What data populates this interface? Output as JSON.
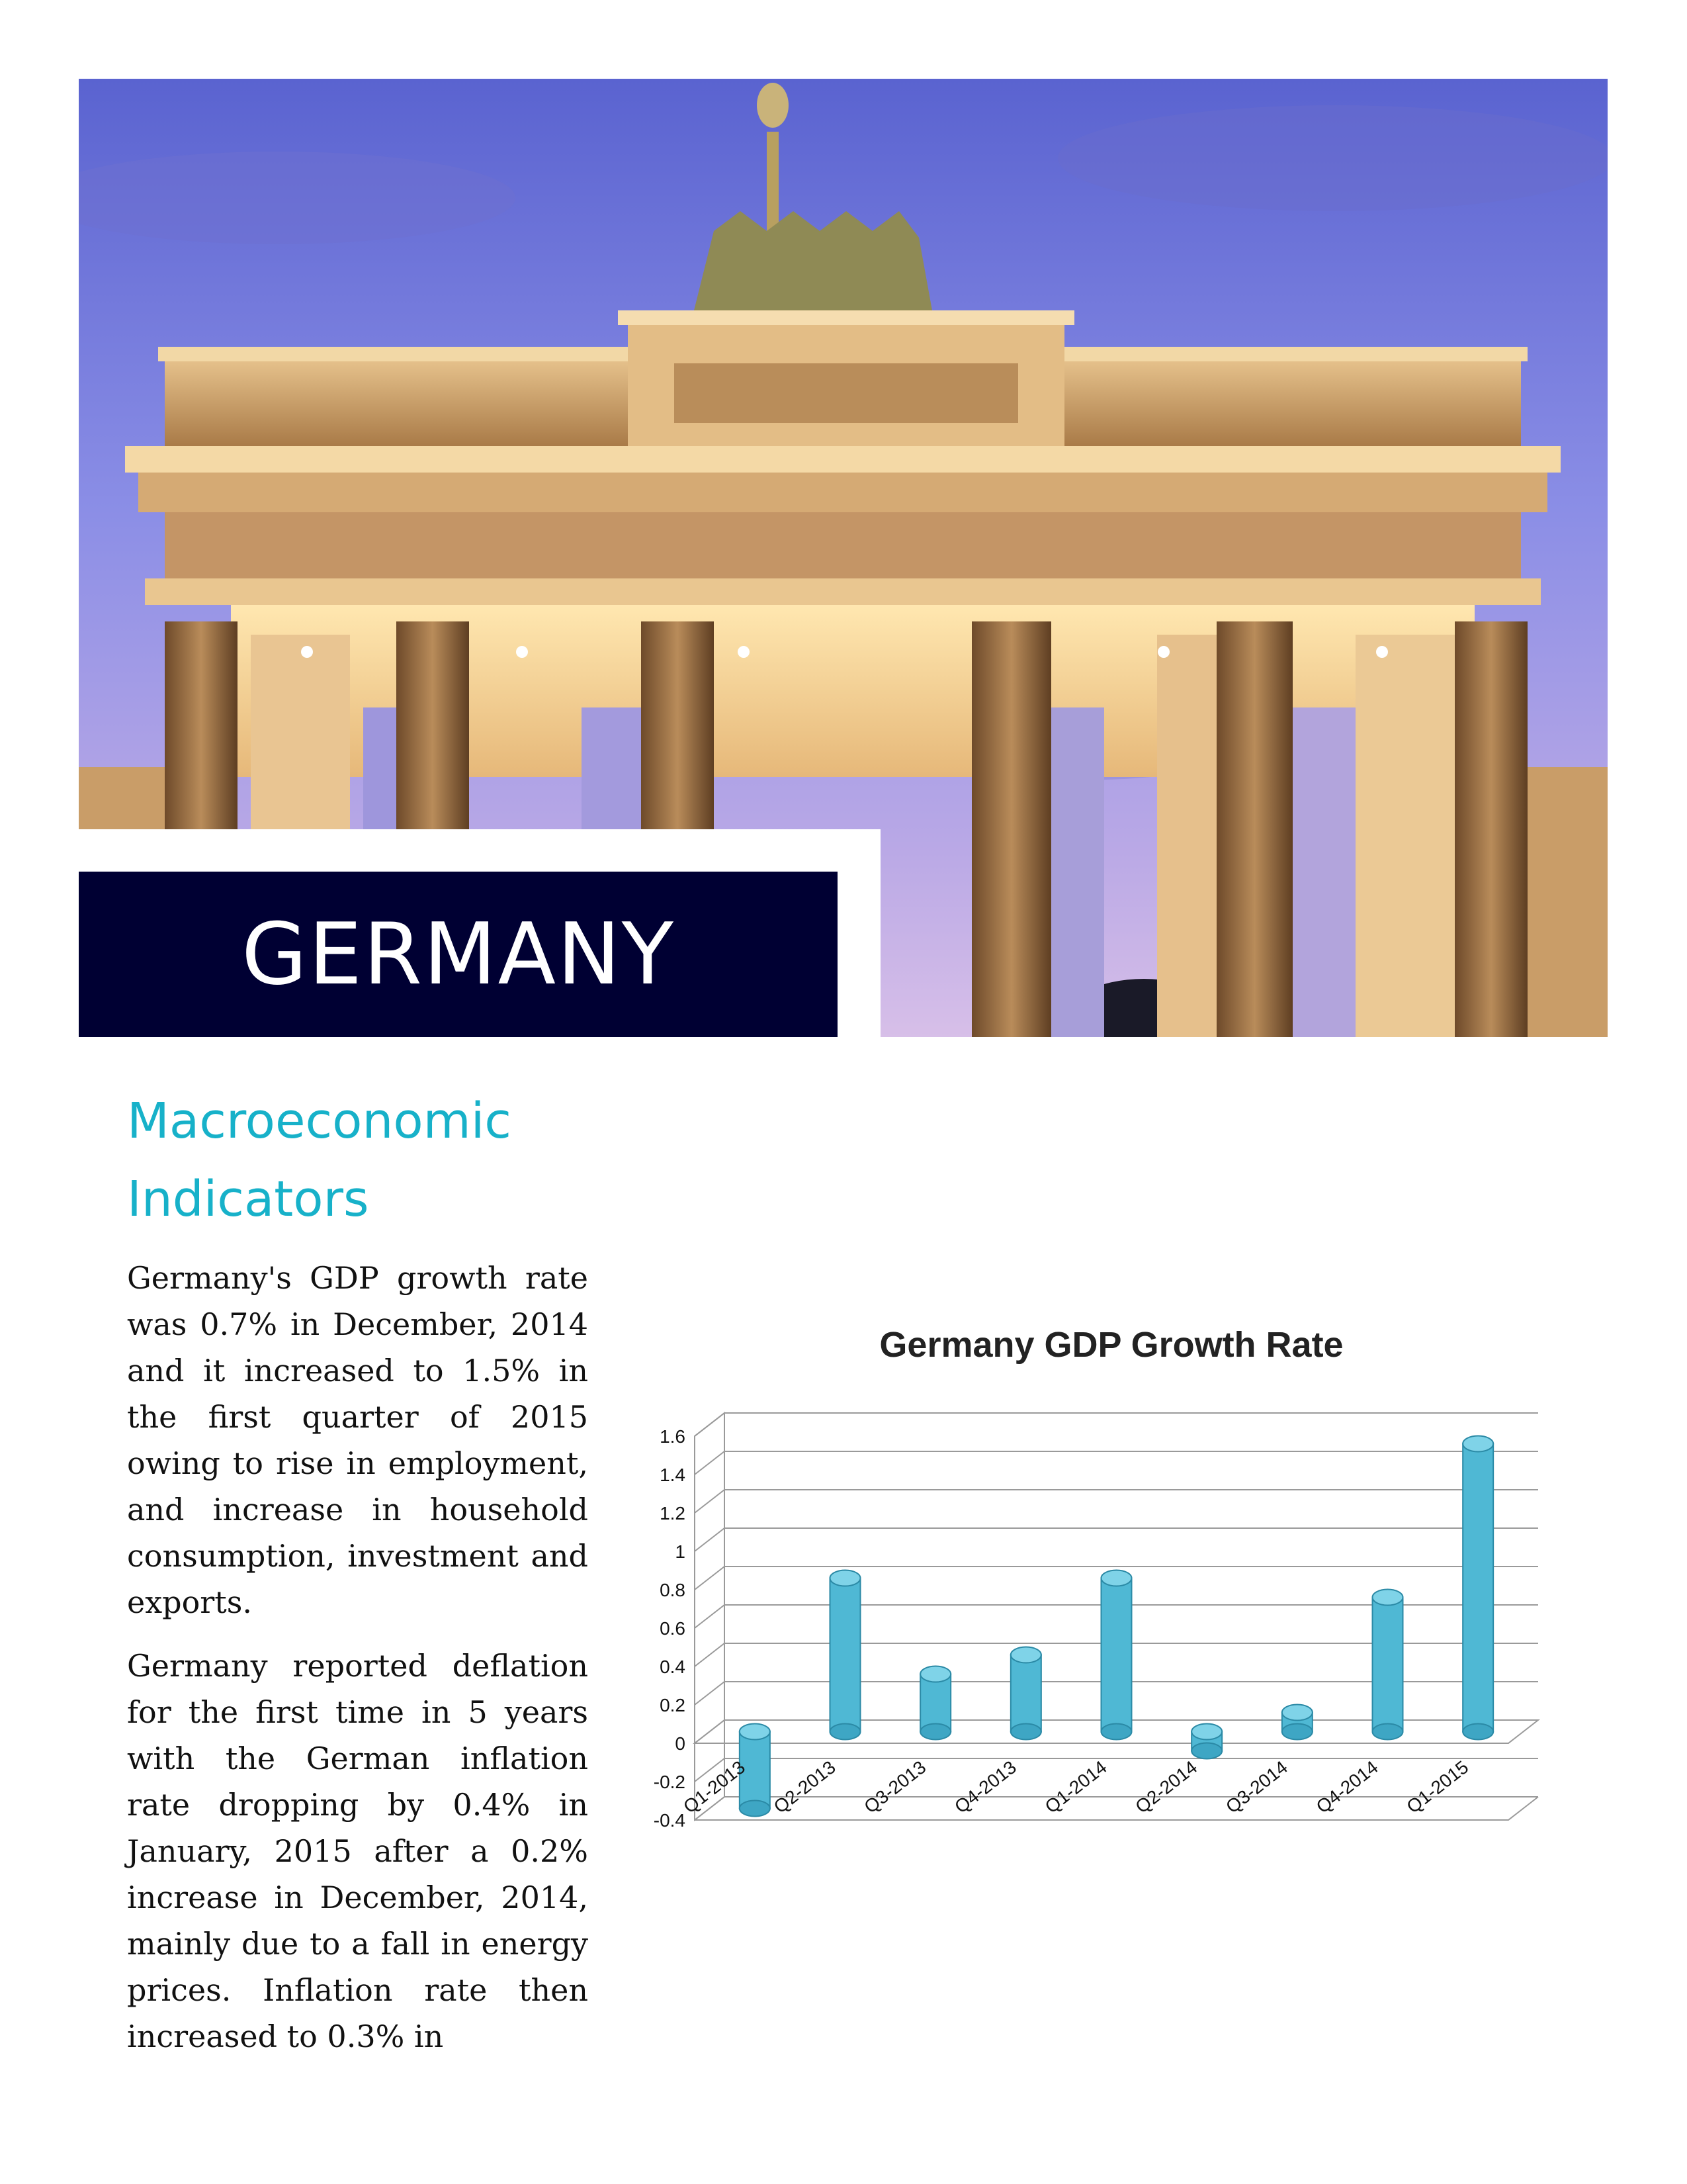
{
  "header": {
    "country": "GERMANY"
  },
  "section": {
    "title": "Macroeconomic Indicators"
  },
  "body": {
    "paragraphs": [
      "Germany's GDP growth rate was 0.7% in December, 2014 and it increased to 1.5% in the first quarter of 2015 owing to rise in employment, and increase in household consumption, investment and exports.",
      "Germany reported deflation for the first time in 5 years with the German inflation rate dropping by 0.4% in January, 2015 after a 0.2% increase in December, 2014, mainly due to a fall in energy prices. Inflation rate then increased to 0.3% in"
    ]
  },
  "colors": {
    "title_box": "#000033",
    "accent": "#17b1c9",
    "bar": "#4fb8d4"
  },
  "chart_data": {
    "type": "bar",
    "title": "Germany GDP Growth Rate",
    "categories": [
      "Q1-2013",
      "Q2-2013",
      "Q3-2013",
      "Q4-2013",
      "Q1-2014",
      "Q2-2014",
      "Q3-2014",
      "Q4-2014",
      "Q1-2015"
    ],
    "values": [
      -0.4,
      0.8,
      0.3,
      0.4,
      0.8,
      -0.1,
      0.1,
      0.7,
      1.5
    ],
    "ylim": [
      -0.4,
      1.6
    ],
    "yticks": [
      -0.4,
      -0.2,
      0,
      0.2,
      0.4,
      0.6,
      0.8,
      1,
      1.2,
      1.4,
      1.6
    ],
    "grid": true,
    "legend": "none",
    "style": "3d-cylinder"
  }
}
